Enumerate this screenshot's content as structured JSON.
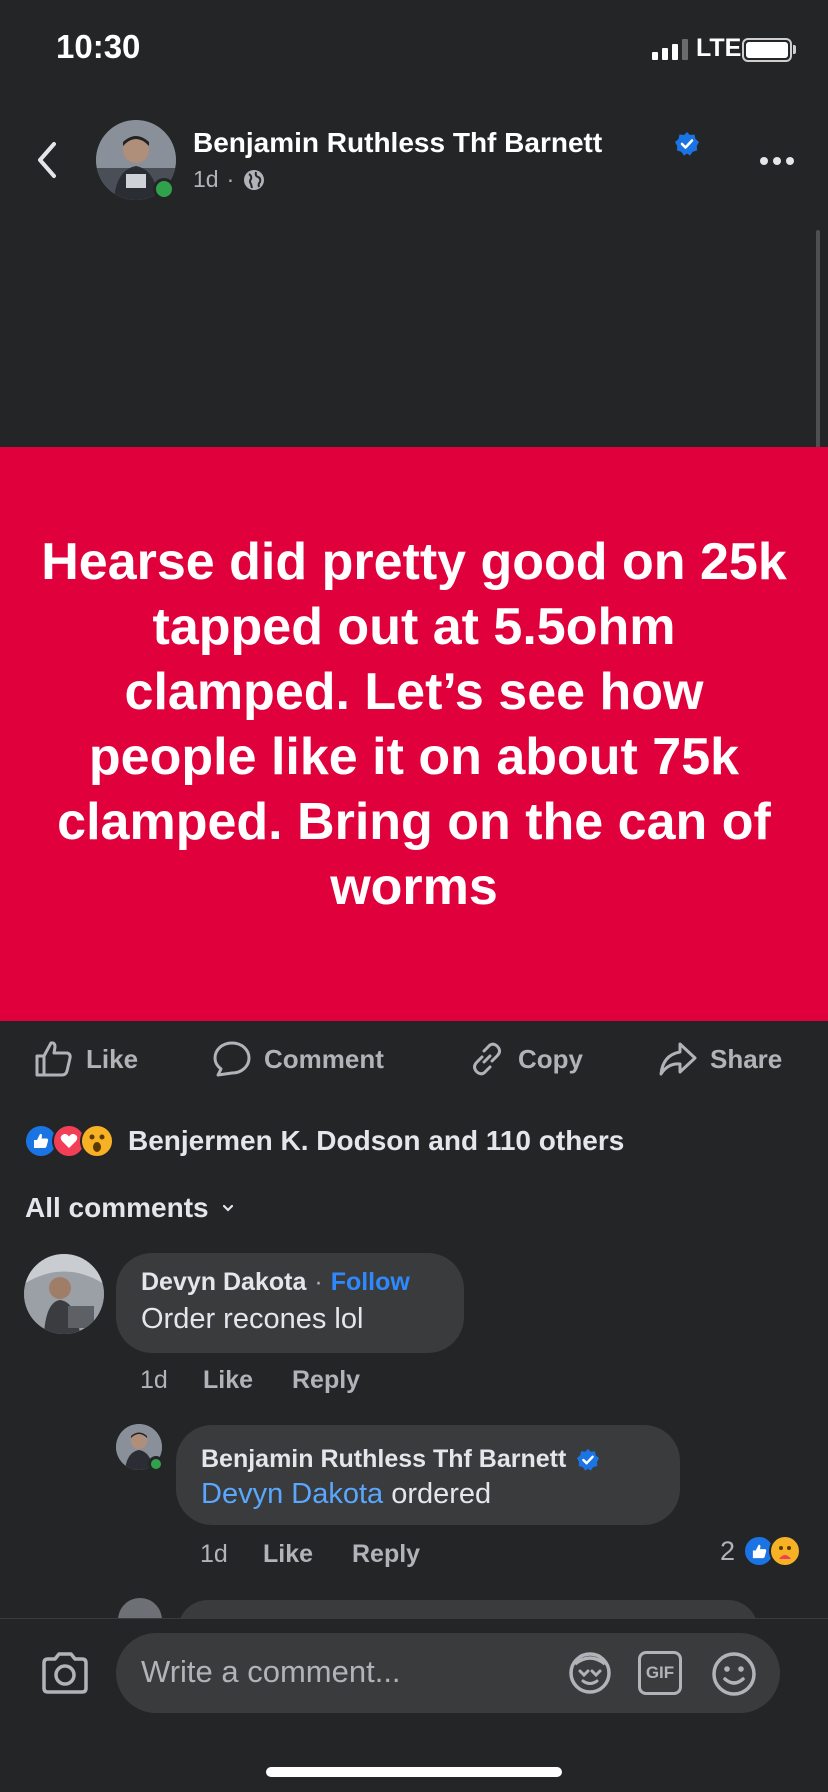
{
  "status_bar": {
    "time": "10:30",
    "network": "LTE"
  },
  "post": {
    "author": "Benjamin Ruthless Thf Barnett",
    "time": "1d",
    "separator": "·",
    "text": "Hearse did pretty good on 25k tapped out at 5.5ohm clamped. Let’s see how people like it on about 75k clamped. Bring on the can of worms",
    "background_color": "#e0003c"
  },
  "actions": {
    "like": "Like",
    "comment": "Comment",
    "copy": "Copy",
    "share": "Share"
  },
  "reactions": {
    "summary": "Benjermen K. Dodson and 110 others",
    "icons": [
      "like-reaction",
      "love-reaction",
      "wow-reaction"
    ]
  },
  "comments_filter": "All comments",
  "comments": [
    {
      "author": "Devyn Dakota",
      "follow_prefix": "·",
      "follow": "Follow",
      "text": "Order recones lol",
      "time": "1d",
      "like": "Like",
      "reply": "Reply"
    }
  ],
  "replies": [
    {
      "author": "Benjamin Ruthless Thf Barnett",
      "mention": "Devyn Dakota",
      "text": " ordered",
      "time": "1d",
      "like": "Like",
      "reply": "Reply",
      "reaction_count": "2"
    }
  ],
  "composer": {
    "placeholder": "Write a comment...",
    "gif_label": "GIF"
  },
  "colors": {
    "accent": "#2e89ff",
    "online": "#31a24c",
    "bubble": "#3a3b3c",
    "background": "#242526"
  }
}
